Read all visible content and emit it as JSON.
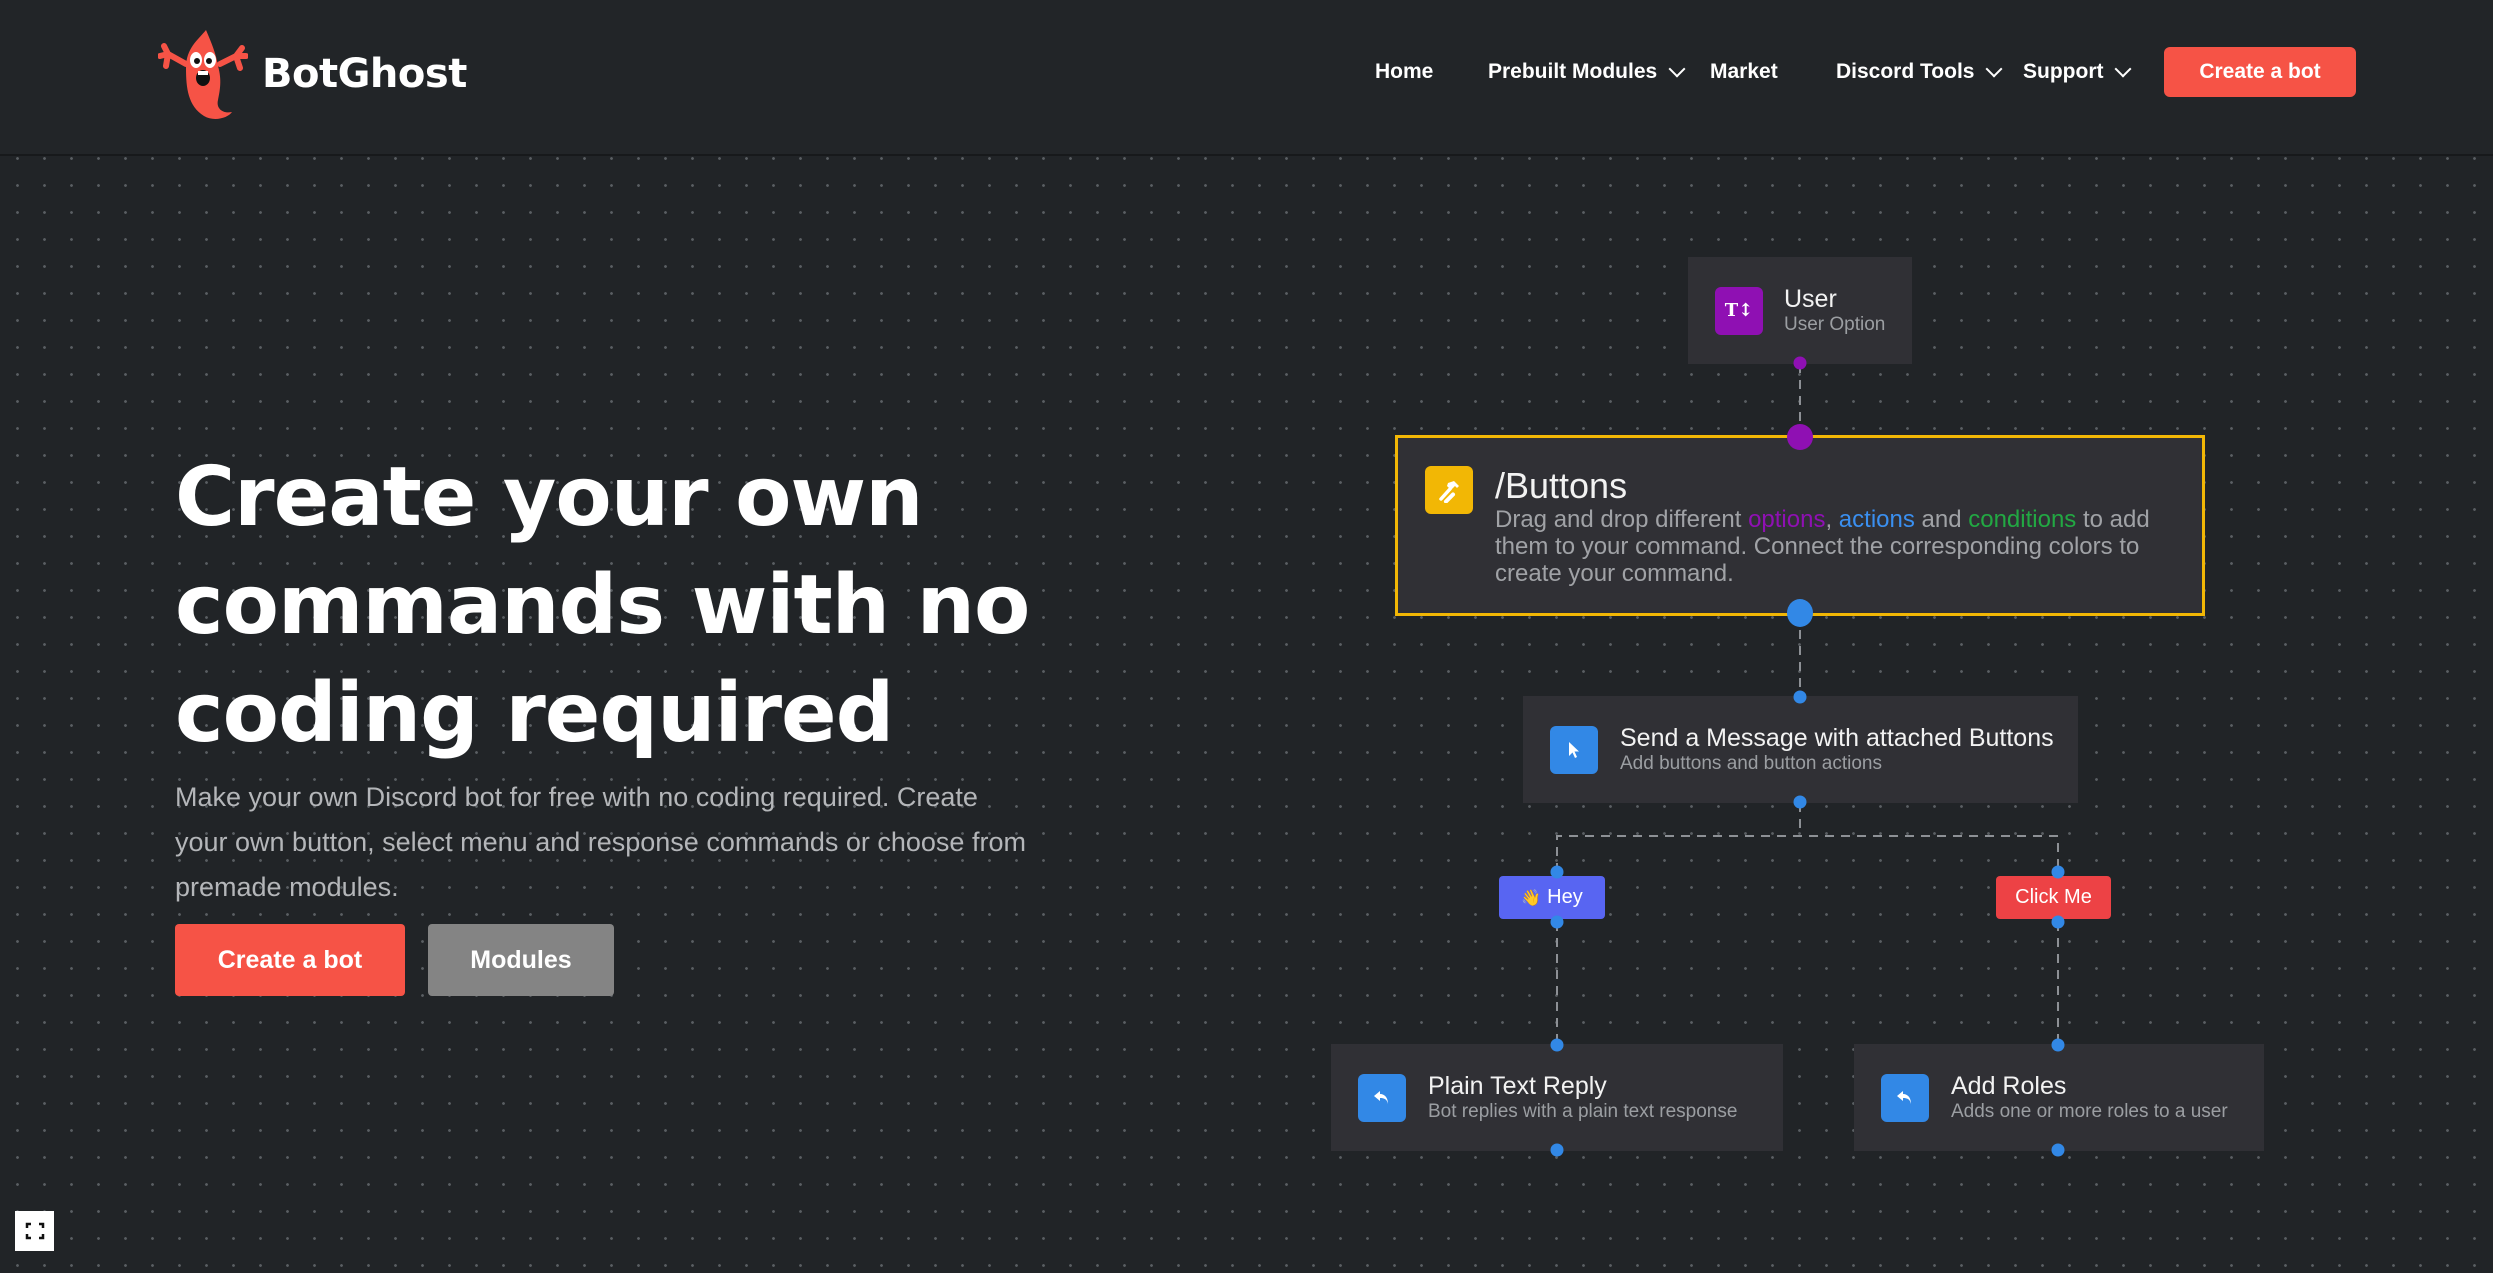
{
  "header": {
    "brand": "BotGhost",
    "nav": [
      {
        "label": "Home",
        "dropdown": false
      },
      {
        "label": "Prebuilt Modules",
        "dropdown": true
      },
      {
        "label": "Market",
        "dropdown": false
      },
      {
        "label": "Discord Tools",
        "dropdown": true
      },
      {
        "label": "Support",
        "dropdown": true
      }
    ],
    "cta_label": "Create a bot"
  },
  "hero": {
    "title": "Create your own commands with no coding required",
    "subtitle": "Make your own Discord bot for free with no coding required. Create your own button, select menu and response commands or choose from premade modules.",
    "primary_label": "Create a bot",
    "secondary_label": "Modules"
  },
  "flow": {
    "option_node": {
      "title": "User",
      "desc": "User Option",
      "icon": "text-option-icon",
      "color": "#8f10b3"
    },
    "command_node": {
      "title": "/Buttons",
      "desc_parts": [
        {
          "text": "Drag and drop different ",
          "kind": "plain"
        },
        {
          "text": "options",
          "kind": "option"
        },
        {
          "text": ", ",
          "kind": "plain"
        },
        {
          "text": "actions",
          "kind": "action"
        },
        {
          "text": " and ",
          "kind": "plain"
        },
        {
          "text": "conditions",
          "kind": "condition"
        },
        {
          "text": " to add them to your command. Connect the corresponding colors to create your command.",
          "kind": "plain"
        }
      ],
      "icon": "hammer-icon",
      "color": "#f2b705"
    },
    "message_node": {
      "title": "Send a Message with attached Buttons",
      "desc": "Add buttons and button actions",
      "icon": "cursor-icon",
      "color": "#3288e6"
    },
    "buttons": [
      {
        "label": "Hey",
        "emoji": "👋",
        "color": "#5865f2"
      },
      {
        "label": "Click Me",
        "emoji": "",
        "color": "#ed4245"
      }
    ],
    "action_nodes": [
      {
        "title": "Plain Text Reply",
        "desc": "Bot replies with a plain text response",
        "icon": "reply-icon",
        "color": "#3288e6"
      },
      {
        "title": "Add Roles",
        "desc": "Adds one or more roles to a user",
        "icon": "reply-icon",
        "color": "#3288e6"
      }
    ],
    "colors": {
      "option": "#8f10b3",
      "action": "#3288e6",
      "condition": "#22a843"
    }
  }
}
